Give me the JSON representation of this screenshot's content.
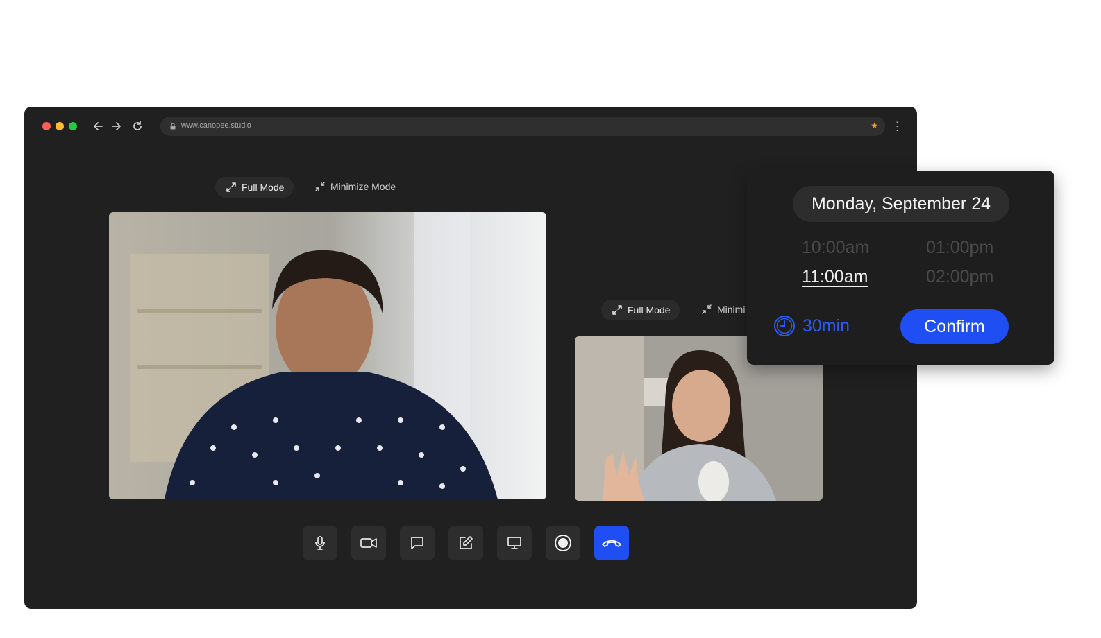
{
  "browser": {
    "url": "www.canopee.studio",
    "traffic_lights": [
      "#ff5f57",
      "#febc2e",
      "#28c840"
    ],
    "star_color": "#f0a020"
  },
  "main_video": {
    "full_mode_label": "Full Mode",
    "minimize_mode_label": "Minimize Mode"
  },
  "secondary_video": {
    "full_mode_label": "Full Mode",
    "minimize_mode_label": "Minimi"
  },
  "controls": [
    {
      "name": "microphone-button",
      "icon": "microphone-icon"
    },
    {
      "name": "camera-button",
      "icon": "video-camera-icon"
    },
    {
      "name": "chat-button",
      "icon": "chat-bubble-icon"
    },
    {
      "name": "edit-button",
      "icon": "edit-icon"
    },
    {
      "name": "screen-share-button",
      "icon": "monitor-icon"
    },
    {
      "name": "record-button",
      "icon": "record-icon"
    },
    {
      "name": "end-call-button",
      "icon": "phone-hangup-icon"
    }
  ],
  "scheduler": {
    "date": "Monday, September 24",
    "times": [
      {
        "label": "10:00am",
        "selected": false
      },
      {
        "label": "01:00pm",
        "selected": false
      },
      {
        "label": "11:00am",
        "selected": true
      },
      {
        "label": "02:00pm",
        "selected": false
      }
    ],
    "duration": "30min",
    "confirm_label": "Confirm",
    "accent_color": "#1f4ff2"
  }
}
